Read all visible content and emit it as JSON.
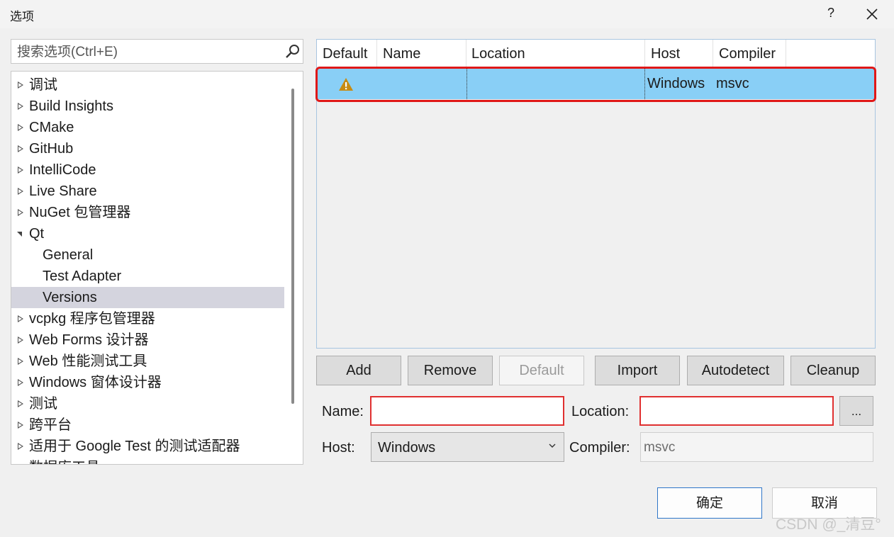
{
  "window": {
    "title": "选项",
    "help": "?"
  },
  "search": {
    "placeholder": "搜索选项(Ctrl+E)",
    "value": ""
  },
  "tree": {
    "items": [
      {
        "label": "调试",
        "expanded": false
      },
      {
        "label": "Build Insights",
        "expanded": false
      },
      {
        "label": "CMake",
        "expanded": false
      },
      {
        "label": "GitHub",
        "expanded": false
      },
      {
        "label": "IntelliCode",
        "expanded": false
      },
      {
        "label": "Live Share",
        "expanded": false
      },
      {
        "label": "NuGet 包管理器",
        "expanded": false
      },
      {
        "label": "Qt",
        "expanded": true
      },
      {
        "label": "General",
        "child": true
      },
      {
        "label": "Test Adapter",
        "child": true
      },
      {
        "label": "Versions",
        "child": true,
        "selected": true
      },
      {
        "label": "vcpkg 程序包管理器",
        "expanded": false
      },
      {
        "label": "Web Forms 设计器",
        "expanded": false
      },
      {
        "label": "Web 性能测试工具",
        "expanded": false
      },
      {
        "label": "Windows 窗体设计器",
        "expanded": false
      },
      {
        "label": "测试",
        "expanded": false
      },
      {
        "label": "跨平台",
        "expanded": false
      },
      {
        "label": "适用于 Google Test 的测试适配器",
        "expanded": false
      },
      {
        "label": "数据库工具",
        "expanded": false
      }
    ]
  },
  "table": {
    "columns": [
      "Default",
      "Name",
      "Location",
      "Host",
      "Compiler"
    ],
    "rows": [
      {
        "default_icon": "warning-icon",
        "name": "",
        "location": "",
        "host": "Windows",
        "compiler": "msvc"
      }
    ]
  },
  "buttons": {
    "add": "Add",
    "remove": "Remove",
    "default": "Default",
    "import": "Import",
    "autodetect": "Autodetect",
    "cleanup": "Cleanup",
    "browse": "..."
  },
  "form": {
    "name_label": "Name:",
    "name_value": "",
    "location_label": "Location:",
    "location_value": "",
    "host_label": "Host:",
    "host_value": "Windows",
    "compiler_label": "Compiler:",
    "compiler_value": "msvc"
  },
  "footer": {
    "ok": "确定",
    "cancel": "取消"
  },
  "watermark": "CSDN @_清豆°",
  "colors": {
    "selected_row": "#89cff6",
    "highlight_border": "#e01818",
    "tree_selection": "#d4d4de",
    "ok_border": "#2f76c8"
  }
}
